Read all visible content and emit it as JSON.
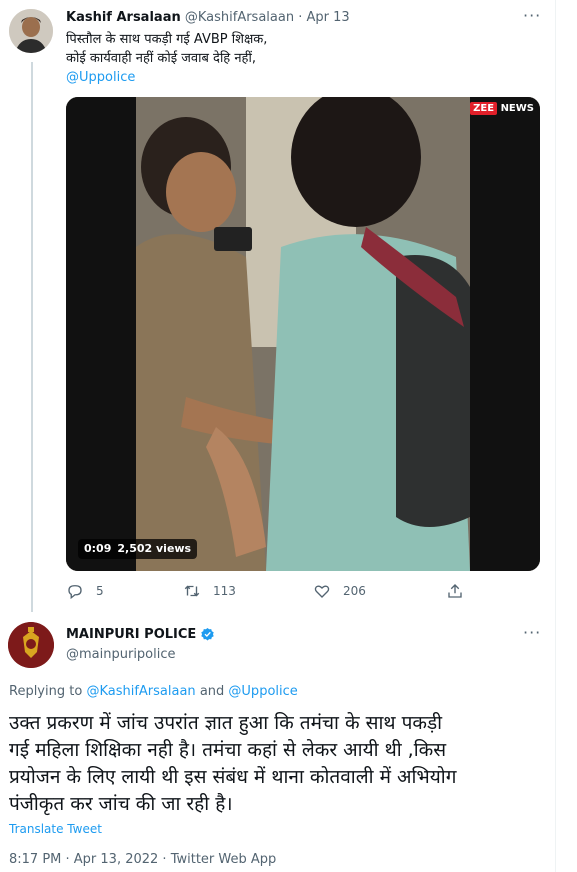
{
  "tweet1": {
    "author_name": "Kashif Arsalaan",
    "author_handle": "@KashifArsalaan",
    "separator": "·",
    "date": "Apr 13",
    "more_label": "···",
    "text_line1": "पिस्तौल के साथ पकड़ी गई AVBP शिक्षक,",
    "text_line2": "कोई कार्यवाही नहीं कोई जवाब देहि नहीं,",
    "mention": "@Uppolice",
    "video": {
      "duration": "0:09",
      "views": "2,502 views",
      "watermark_zee": "ZEE",
      "watermark_news": "NEWS"
    },
    "actions": {
      "reply_icon": "reply-icon",
      "reply_count": "5",
      "retweet_icon": "retweet-icon",
      "retweet_count": "113",
      "like_icon": "heart-icon",
      "like_count": "206",
      "share_icon": "share-icon"
    }
  },
  "tweet2": {
    "author_name": "MAINPURI POLICE",
    "verified_icon": "verified-badge-icon",
    "author_handle": "@mainpuripolice",
    "more_label": "···",
    "replying_prefix": "Replying to",
    "replying_to_1": "@KashifArsalaan",
    "replying_and": "and",
    "replying_to_2": "@Uppolice",
    "text_line1": "उक्त प्रकरण में जांच उपरांत ज्ञात हुआ कि तमंचा के साथ पकड़ी",
    "text_line2": "गई महिला शिक्षिका नही है। तमंचा कहां से लेकर आयी थी ,किस",
    "text_line3": "प्रयोजन के लिए लायी थी इस संबंध में थाना कोतवाली में अभियोग",
    "text_line4": "पंजीकृत कर जांच की जा रही है।",
    "translate_label": "Translate Tweet",
    "timestamp": "8:17 PM · Apr 13, 2022 · Twitter Web App"
  },
  "colors": {
    "link": "#1d9bf0",
    "secondary_text": "#536471",
    "primary_text": "#0f1419",
    "verified": "#1d9bf0"
  }
}
